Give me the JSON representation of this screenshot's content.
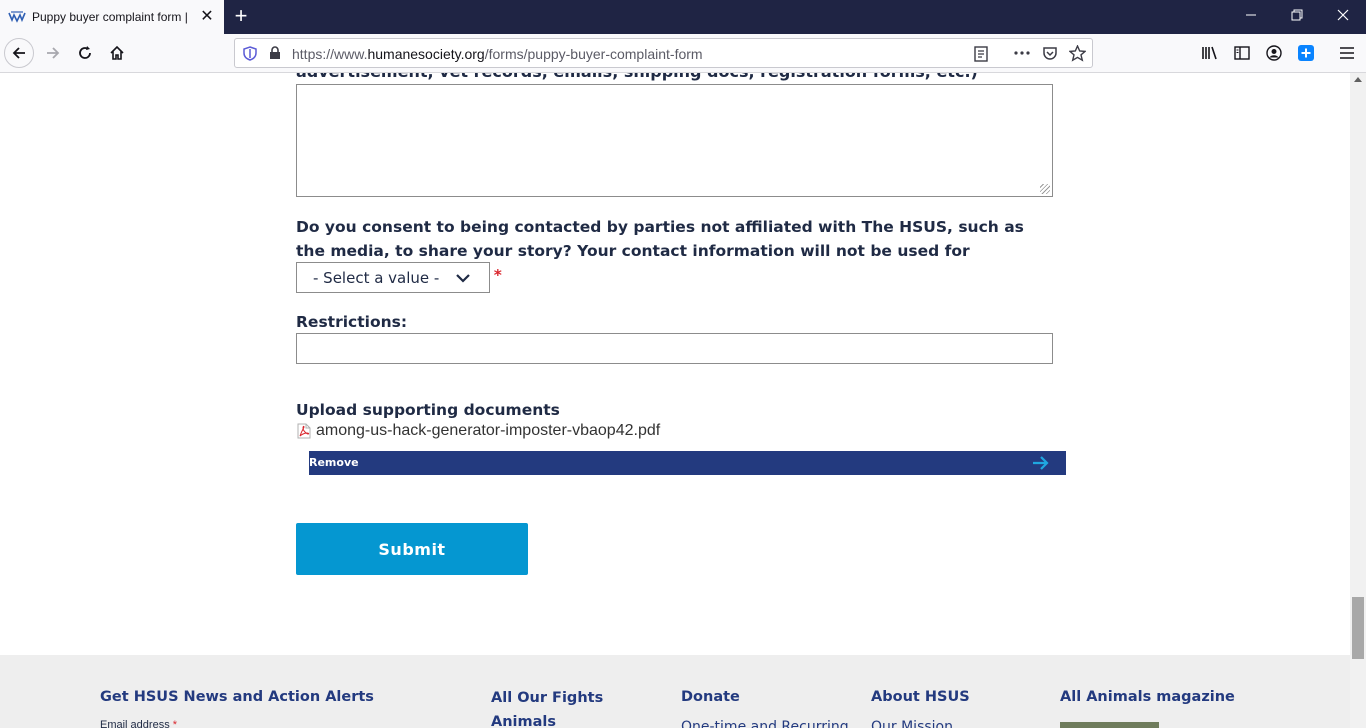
{
  "browser": {
    "tab_title": "Puppy buyer complaint form |",
    "url_prefix": "https://www.",
    "url_host": "humanesociety.org",
    "url_path": "/forms/puppy-buyer-complaint-form"
  },
  "form": {
    "cut_label": "advertisement, vet records, emails, shipping docs, registration forms, etc.)",
    "consent_label": "Do you consent to being contacted by parties not affiliated with The HSUS, such as the media, to share your story? Your contact information will not be used for fundraising purposes.",
    "required_mark": "*",
    "select_value": "- Select a value -",
    "restrictions_label": "Restrictions:",
    "upload_label": "Upload supporting documents",
    "file_name": "among-us-hack-generator-imposter-vbaop42.pdf",
    "remove_label": "Remove",
    "submit_label": "Submit"
  },
  "footer": {
    "news_heading": "Get HSUS News and Action Alerts",
    "email_label": "Email address",
    "fights_heading": "All Our Fights",
    "animals_link": "Animals",
    "donate_heading": "Donate",
    "donate_link": "One-time and Recurring",
    "about_heading": "About HSUS",
    "about_link": "Our Mission",
    "magazine_heading": "All Animals magazine"
  },
  "colors": {
    "navy": "#233a7f",
    "submit_blue": "#0597d1",
    "required_red": "#d9272e",
    "footer_bg": "#eeeeee"
  }
}
